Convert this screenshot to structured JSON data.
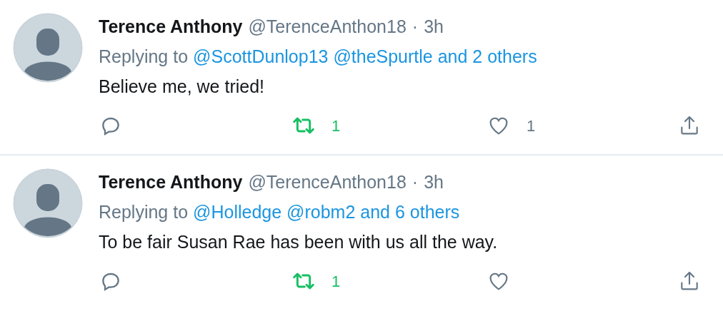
{
  "tweets": [
    {
      "name": "Terence Anthony",
      "handle": "@TerenceAnthon18",
      "separator": "·",
      "time": "3h",
      "replying_label": "Replying to",
      "mentions": "@ScottDunlop13 @theSpurtle and 2 others",
      "text": "Believe me, we tried!",
      "retweet_count": "1",
      "retweeted": true,
      "like_count": "1",
      "liked": false
    },
    {
      "name": "Terence Anthony",
      "handle": "@TerenceAnthon18",
      "separator": "·",
      "time": "3h",
      "replying_label": "Replying to",
      "mentions": "@Holledge @robm2 and 6 others",
      "text": "To be fair Susan Rae has been with us all the way.",
      "retweet_count": "1",
      "retweeted": true,
      "liked": false
    }
  ]
}
